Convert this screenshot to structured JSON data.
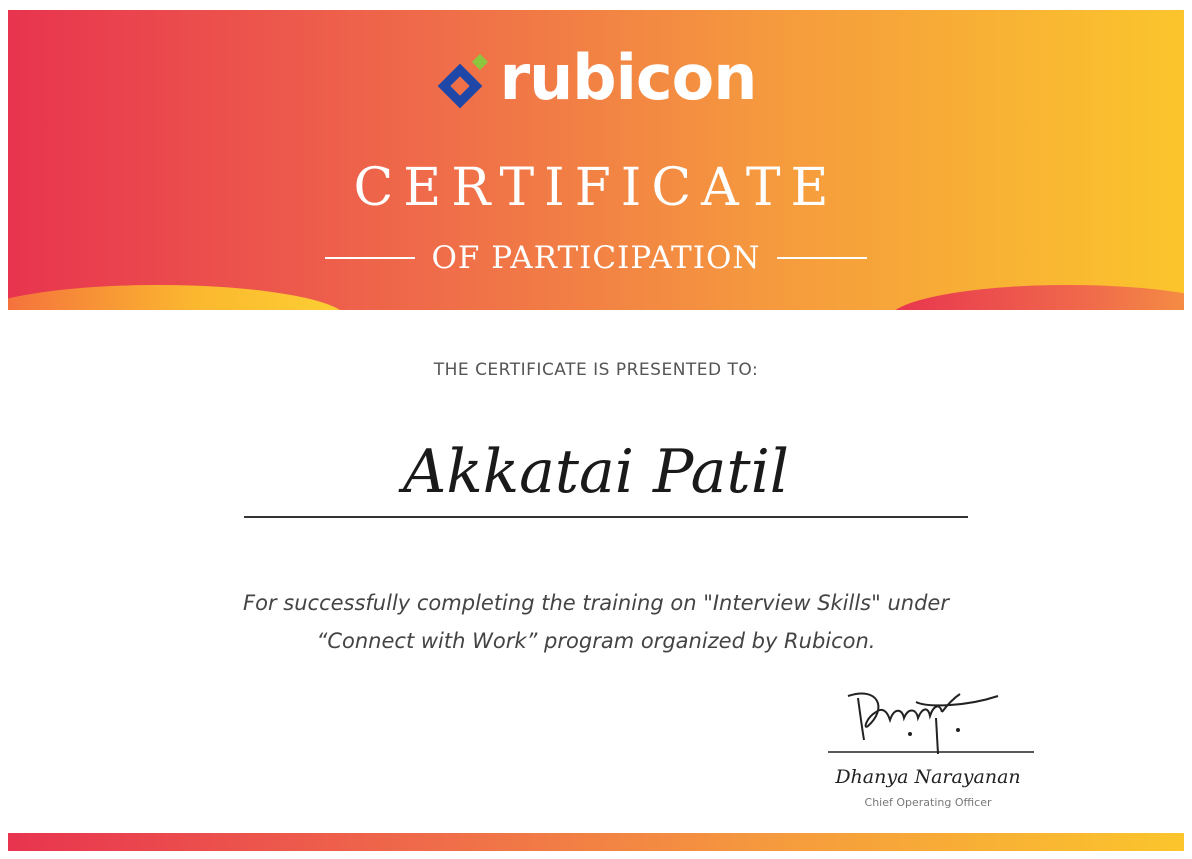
{
  "brand": {
    "logo_text": "rubicon",
    "logo_icon": "rubicon-diamond-icon",
    "logo_colors": [
      "#1f47a8",
      "#8cc63f"
    ]
  },
  "certificate": {
    "title": "CERTIFICATE",
    "subtitle": "OF PARTICIPATION",
    "presented_to_label": "THE CERTIFICATE IS PRESENTED TO:",
    "recipient_name": "Akkatai Patil",
    "description_line_1": "For successfully completing the training on \"Interview Skills\" under",
    "description_line_2": "“Connect with Work” program organized by Rubicon."
  },
  "signatory": {
    "signature_text": "Dhanya",
    "name": "Dhanya Narayanan",
    "title": "Chief Operating Officer"
  },
  "colors": {
    "gradient_start": "#e8344f",
    "gradient_mid": "#f59a3e",
    "gradient_end": "#fbc52c"
  }
}
